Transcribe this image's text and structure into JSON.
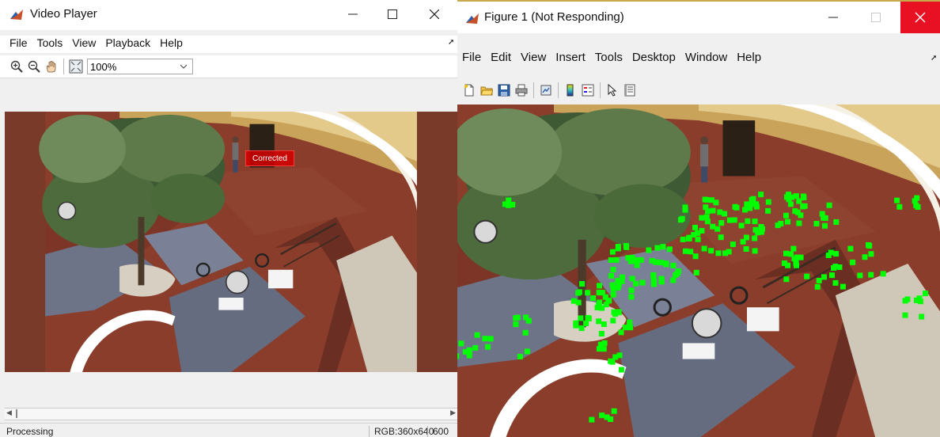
{
  "video_player": {
    "title": "Video Player",
    "menu": [
      "File",
      "Tools",
      "View",
      "Playback",
      "Help"
    ],
    "toolbar": {
      "icons": [
        "zoom-in-icon",
        "zoom-out-icon",
        "pan-hand-icon",
        "fit-to-window-icon"
      ],
      "zoom_value": "100%"
    },
    "overlay_label": "Corrected",
    "status": {
      "left": "Processing",
      "resolution": "RGB:360x640",
      "frame": "600"
    }
  },
  "figure": {
    "title": "Figure 1 (Not Responding)",
    "menu": [
      "File",
      "Edit",
      "View",
      "Insert",
      "Tools",
      "Desktop",
      "Window",
      "Help"
    ],
    "toolbar_icons": [
      "new-figure-icon",
      "open-file-icon",
      "save-icon",
      "print-icon",
      "link-plot-icon",
      "insert-colorbar-icon",
      "insert-legend-icon",
      "edit-plot-arrow-icon",
      "property-inspector-icon"
    ],
    "feature_color": "#00ff00"
  },
  "colors": {
    "close_button": "#e81123",
    "overlay_box": "#d40000"
  }
}
